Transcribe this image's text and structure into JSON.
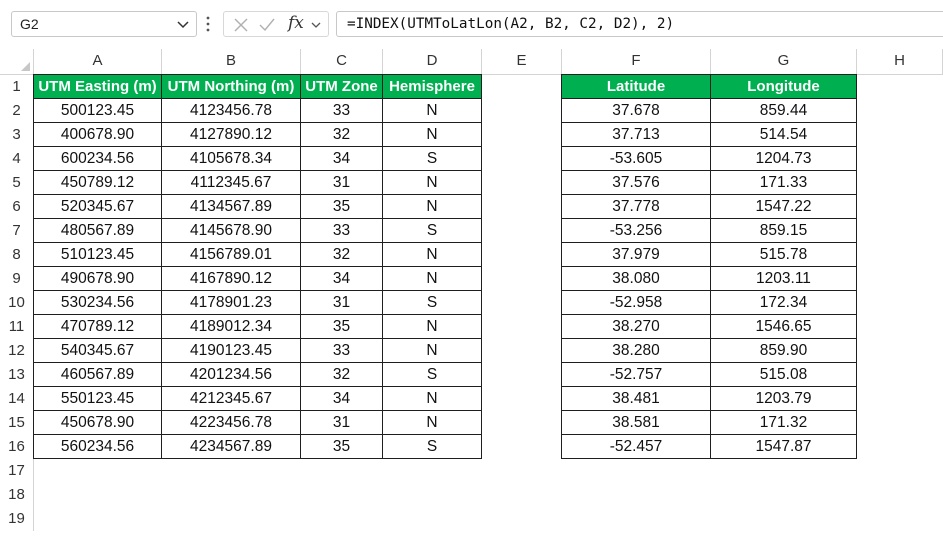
{
  "name_box": {
    "value": "G2"
  },
  "formula_bar": {
    "formula": "=INDEX(UTMToLatLon(A2, B2, C2, D2), 2)",
    "fx_label": "fx"
  },
  "columns": [
    "A",
    "B",
    "C",
    "D",
    "E",
    "F",
    "G",
    "H"
  ],
  "rows": [
    "1",
    "2",
    "3",
    "4",
    "5",
    "6",
    "7",
    "8",
    "9",
    "10",
    "11",
    "12",
    "13",
    "14",
    "15",
    "16",
    "17",
    "18",
    "19"
  ],
  "input_table": {
    "headers": [
      "UTM Easting (m)",
      "UTM Northing (m)",
      "UTM Zone",
      "Hemisphere"
    ],
    "rows": [
      [
        "500123.45",
        "4123456.78",
        "33",
        "N"
      ],
      [
        "400678.90",
        "4127890.12",
        "32",
        "N"
      ],
      [
        "600234.56",
        "4105678.34",
        "34",
        "S"
      ],
      [
        "450789.12",
        "4112345.67",
        "31",
        "N"
      ],
      [
        "520345.67",
        "4134567.89",
        "35",
        "N"
      ],
      [
        "480567.89",
        "4145678.90",
        "33",
        "S"
      ],
      [
        "510123.45",
        "4156789.01",
        "32",
        "N"
      ],
      [
        "490678.90",
        "4167890.12",
        "34",
        "N"
      ],
      [
        "530234.56",
        "4178901.23",
        "31",
        "S"
      ],
      [
        "470789.12",
        "4189012.34",
        "35",
        "N"
      ],
      [
        "540345.67",
        "4190123.45",
        "33",
        "N"
      ],
      [
        "460567.89",
        "4201234.56",
        "32",
        "S"
      ],
      [
        "550123.45",
        "4212345.67",
        "34",
        "N"
      ],
      [
        "450678.90",
        "4223456.78",
        "31",
        "N"
      ],
      [
        "560234.56",
        "4234567.89",
        "35",
        "S"
      ]
    ]
  },
  "output_table": {
    "headers": [
      "Latitude",
      "Longitude"
    ],
    "rows": [
      [
        "37.678",
        "859.44"
      ],
      [
        "37.713",
        "514.54"
      ],
      [
        "-53.605",
        "1204.73"
      ],
      [
        "37.576",
        "171.33"
      ],
      [
        "37.778",
        "1547.22"
      ],
      [
        "-53.256",
        "859.15"
      ],
      [
        "37.979",
        "515.78"
      ],
      [
        "38.080",
        "1203.11"
      ],
      [
        "-52.958",
        "172.34"
      ],
      [
        "38.270",
        "1546.65"
      ],
      [
        "38.280",
        "859.90"
      ],
      [
        "-52.757",
        "515.08"
      ],
      [
        "38.481",
        "1203.79"
      ],
      [
        "38.581",
        "171.32"
      ],
      [
        "-52.457",
        "1547.87"
      ]
    ]
  },
  "colors": {
    "header_fill": "#00b050",
    "header_text": "#ffffff"
  }
}
